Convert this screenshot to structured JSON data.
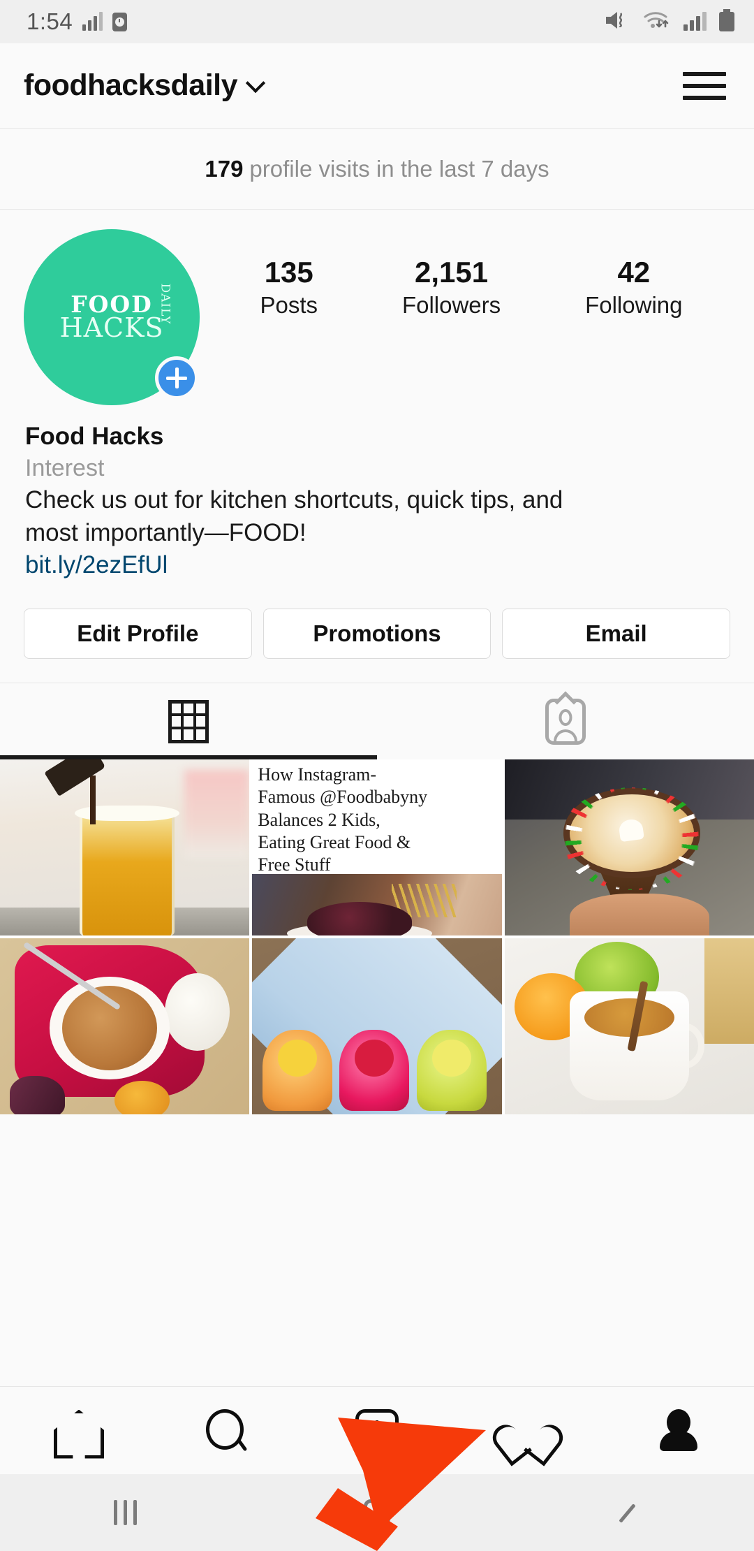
{
  "status_bar": {
    "time": "1:54",
    "icons": [
      "signal-bars-icon",
      "alarm-icon",
      "mute-vibrate-icon",
      "wifi-icon",
      "signal-bars-icon",
      "battery-icon"
    ]
  },
  "header": {
    "username": "foodhacksdaily",
    "dropdown_icon": "chevron-down-icon",
    "menu_icon": "hamburger-menu-icon"
  },
  "insights": {
    "count": "179",
    "text": "profile visits in the last 7 days"
  },
  "profile": {
    "avatar": {
      "alt": "Food Hacks Daily logo",
      "logo_line1": "FOOD",
      "logo_line2": "HACKS",
      "logo_line3": "DAILY",
      "background_color": "#2fcc9b",
      "add_story_badge": "plus-icon",
      "badge_color": "#3a8fe8"
    },
    "stats": [
      {
        "value": "135",
        "label": "Posts"
      },
      {
        "value": "2,151",
        "label": "Followers"
      },
      {
        "value": "42",
        "label": "Following"
      }
    ],
    "bio": {
      "name": "Food Hacks",
      "category": "Interest",
      "description_line1": "Check us out for kitchen shortcuts, quick tips, and",
      "description_line2": "most importantly—FOOD!",
      "link": "bit.ly/2ezEfUl",
      "link_color": "#00466e"
    },
    "actions": [
      {
        "label": "Edit Profile"
      },
      {
        "label": "Promotions"
      },
      {
        "label": "Email"
      }
    ]
  },
  "tabs": [
    {
      "name": "grid",
      "icon": "grid-icon",
      "active": true
    },
    {
      "name": "tagged",
      "icon": "tagged-person-icon",
      "active": false
    }
  ],
  "posts": [
    {
      "id": "post-1",
      "type": "photo",
      "description": "Beer being poured into a tall glass"
    },
    {
      "id": "post-2",
      "type": "article-card",
      "title_line1": "How Instagram-",
      "title_line2": "Famous @Foodbabyny",
      "title_line3": "Balances 2 Kids,",
      "title_line4": "Eating Great Food &",
      "title_line5": "Free Stuff"
    },
    {
      "id": "post-3",
      "type": "photo",
      "description": "Chocolate dipped ice cream cone with sprinkles"
    },
    {
      "id": "post-4",
      "type": "photo",
      "description": "Bowl of granola on a red cloth"
    },
    {
      "id": "post-5",
      "type": "photo",
      "description": "Colorful fruit cupcakes on a blue plate"
    },
    {
      "id": "post-6",
      "type": "photo",
      "description": "Mug of apple cider with cinnamon stick"
    }
  ],
  "bottom_nav": [
    {
      "name": "home",
      "icon": "home-icon",
      "active": false
    },
    {
      "name": "search",
      "icon": "search-icon",
      "active": false
    },
    {
      "name": "new-post",
      "icon": "plus-square-icon",
      "active": false
    },
    {
      "name": "activity",
      "icon": "heart-icon",
      "active": false
    },
    {
      "name": "profile",
      "icon": "person-icon",
      "active": true
    }
  ],
  "system_nav": [
    {
      "name": "recents",
      "icon": "recents-icon"
    },
    {
      "name": "home",
      "icon": "home-square-icon"
    },
    {
      "name": "back",
      "icon": "back-icon"
    }
  ],
  "annotation": {
    "type": "arrow",
    "color": "#f63a0a",
    "points_to": "profile-tab"
  }
}
